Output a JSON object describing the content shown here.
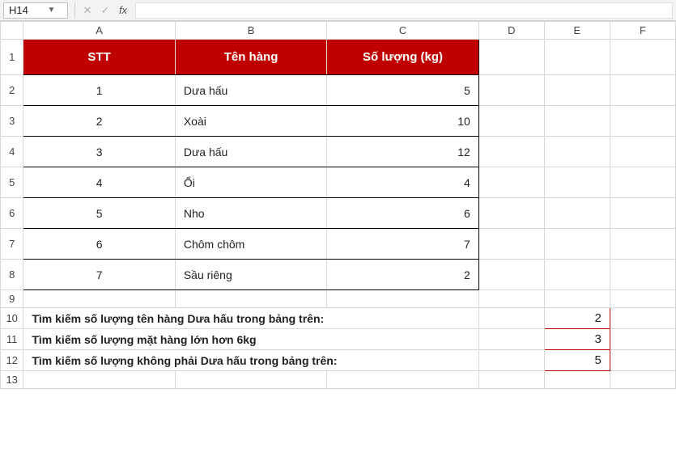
{
  "formula_bar": {
    "name_box": "H14",
    "cancel_icon": "✕",
    "enter_icon": "✓",
    "fx_label": "fx",
    "formula_value": ""
  },
  "columns": [
    "A",
    "B",
    "C",
    "D",
    "E",
    "F"
  ],
  "rows": [
    "1",
    "2",
    "3",
    "4",
    "5",
    "6",
    "7",
    "8",
    "9",
    "10",
    "11",
    "12",
    "13"
  ],
  "table": {
    "headers": {
      "stt": "STT",
      "name": "Tên hàng",
      "qty": "Số lượng (kg)"
    },
    "rows": [
      {
        "stt": "1",
        "name": "Dưa hấu",
        "qty": "5"
      },
      {
        "stt": "2",
        "name": "Xoài",
        "qty": "10"
      },
      {
        "stt": "3",
        "name": "Dưa hấu",
        "qty": "12"
      },
      {
        "stt": "4",
        "name": "Ổi",
        "qty": "4"
      },
      {
        "stt": "5",
        "name": "Nho",
        "qty": "6"
      },
      {
        "stt": "6",
        "name": "Chôm chôm",
        "qty": "7"
      },
      {
        "stt": "7",
        "name": "Sầu riêng",
        "qty": "2"
      }
    ]
  },
  "queries": [
    {
      "text": "Tìm kiếm số lượng tên hàng Dưa hấu trong bảng trên:",
      "result": "2"
    },
    {
      "text": "Tìm kiếm số lượng mặt hàng lớn hơn 6kg",
      "result": "3"
    },
    {
      "text": "Tìm kiếm số lượng không phải Dưa hấu trong bảng trên:",
      "result": "5"
    }
  ]
}
